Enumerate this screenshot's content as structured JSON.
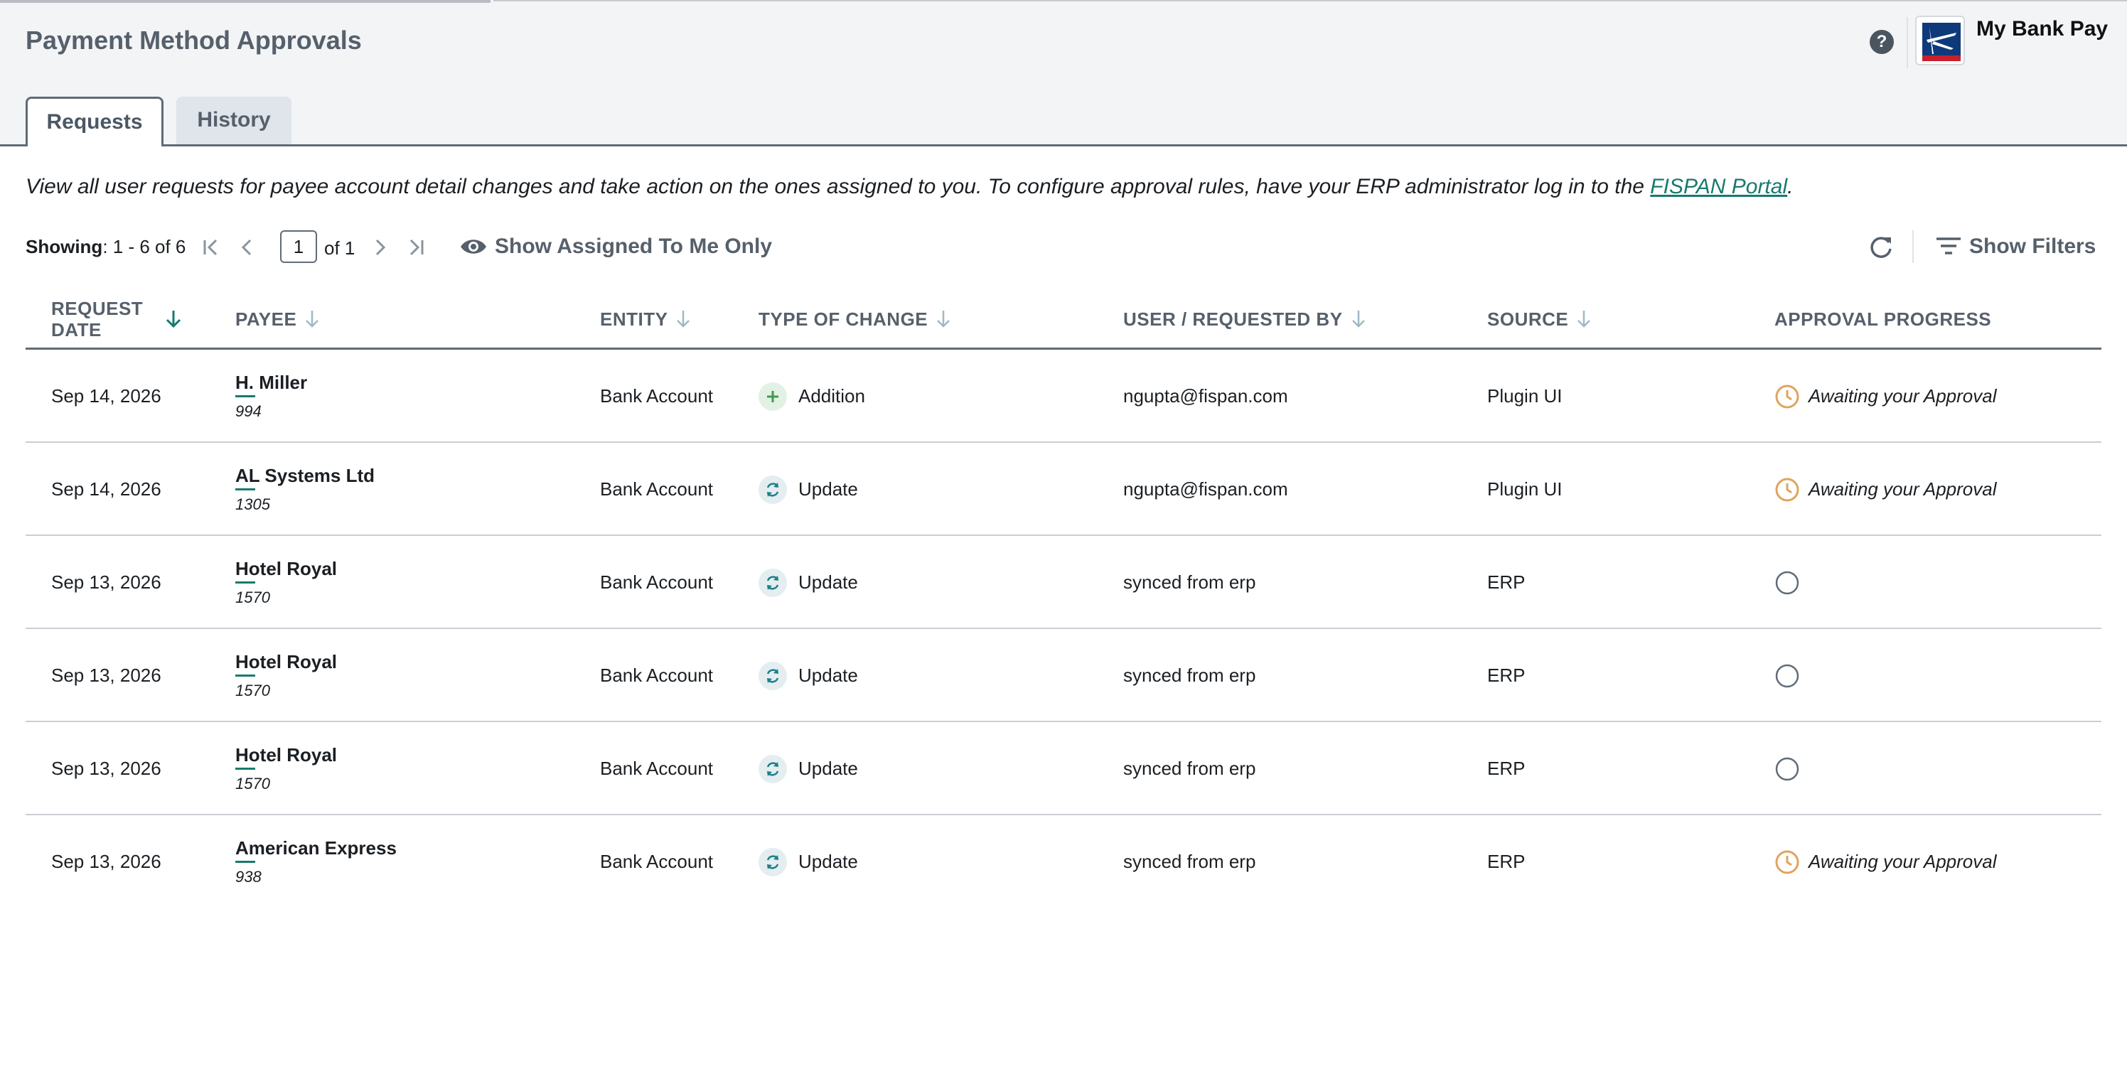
{
  "header": {
    "title": "Payment Method Approvals",
    "help_icon": "question-circle-icon",
    "help_glyph": "?",
    "brand_name": "My Bank Pay",
    "brand_logo": "bank-logo-icon"
  },
  "tabs": [
    {
      "label": "Requests",
      "active": true
    },
    {
      "label": "History",
      "active": false
    }
  ],
  "description": {
    "text": "View all user requests for payee account detail changes and take action on the ones assigned to you. To configure approval rules, have your ERP administrator log in to the ",
    "link_text": "FISPAN Portal",
    "suffix": "."
  },
  "toolbar": {
    "showing_label": "Showing",
    "showing_range": ": 1 - 6 of 6",
    "page_value": "1",
    "page_of": "of 1",
    "assigned_label": "Show Assigned To Me Only",
    "filters_label": "Show Filters"
  },
  "table": {
    "columns": [
      {
        "label": "REQUEST DATE",
        "sort": "active-down"
      },
      {
        "label": "PAYEE",
        "sort": "down"
      },
      {
        "label": "ENTITY",
        "sort": "down"
      },
      {
        "label": "TYPE OF CHANGE",
        "sort": "down"
      },
      {
        "label": "USER / REQUESTED BY",
        "sort": "down"
      },
      {
        "label": "SOURCE",
        "sort": "down"
      },
      {
        "label": "APPROVAL PROGRESS",
        "sort": "none"
      }
    ],
    "rows": [
      {
        "date": "Sep 14, 2026",
        "payee": "H. Miller",
        "payee_id": "994",
        "entity": "Bank Account",
        "change": "Addition",
        "change_icon": "plus-icon",
        "user": "ngupta@fispan.com",
        "source": "Plugin UI",
        "status": "Awaiting your Approval",
        "status_icon": "clock-icon"
      },
      {
        "date": "Sep 14, 2026",
        "payee": "AL Systems Ltd",
        "payee_id": "1305",
        "entity": "Bank Account",
        "change": "Update",
        "change_icon": "refresh-icon",
        "user": "ngupta@fispan.com",
        "source": "Plugin UI",
        "status": "Awaiting your Approval",
        "status_icon": "clock-icon"
      },
      {
        "date": "Sep 13, 2026",
        "payee": "Hotel Royal",
        "payee_id": "1570",
        "entity": "Bank Account",
        "change": "Update",
        "change_icon": "refresh-icon",
        "user": "synced from erp",
        "source": "ERP",
        "status": "",
        "status_icon": "empty-circle-icon"
      },
      {
        "date": "Sep 13, 2026",
        "payee": "Hotel Royal",
        "payee_id": "1570",
        "entity": "Bank Account",
        "change": "Update",
        "change_icon": "refresh-icon",
        "user": "synced from erp",
        "source": "ERP",
        "status": "",
        "status_icon": "empty-circle-icon"
      },
      {
        "date": "Sep 13, 2026",
        "payee": "Hotel Royal",
        "payee_id": "1570",
        "entity": "Bank Account",
        "change": "Update",
        "change_icon": "refresh-icon",
        "user": "synced from erp",
        "source": "ERP",
        "status": "",
        "status_icon": "empty-circle-icon"
      },
      {
        "date": "Sep 13, 2026",
        "payee": "American Express",
        "payee_id": "938",
        "entity": "Bank Account",
        "change": "Update",
        "change_icon": "refresh-icon",
        "user": "synced from erp",
        "source": "ERP",
        "status": "Awaiting your Approval",
        "status_icon": "clock-icon"
      }
    ]
  },
  "colors": {
    "accent": "#187a6e",
    "title_gray": "#56606b",
    "clock_orange": "#e0a45e",
    "add_green": "#3f9a4c",
    "update_teal": "#1d7f86",
    "empty_circle": "#5f6b76"
  }
}
